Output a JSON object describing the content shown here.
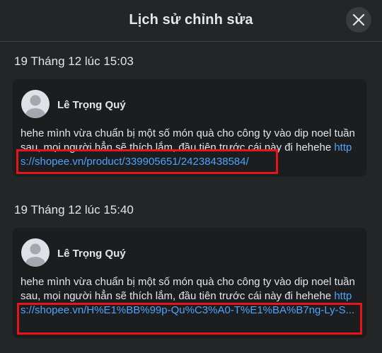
{
  "dialog": {
    "title": "Lịch sử chỉnh sửa",
    "close_icon": "close-icon"
  },
  "entries": [
    {
      "timestamp": "19 Tháng 12 lúc 15:03",
      "author": "Lê Trọng Quý",
      "text": "hehe mình vừa chuẩn bị một số món quà cho công ty vào dip noel tuần sau, mọi người hẳn sẽ thích lắm, đầu tiên trước cái này đi hehehe",
      "link": "https://shopee.vn/product/339905651/24238438584/"
    },
    {
      "timestamp": "19 Tháng 12 lúc 15:40",
      "author": "Lê Trọng Quý",
      "text": "hehe mình vừa chuẩn bị một số món quà cho công ty vào dip noel tuần sau, mọi người hẳn sẽ thích lắm, đầu tiên trước cái này đi hehehe",
      "link": "https://shopee.vn/H%E1%BB%99p-Qu%C3%A0-T%E1%BA%B7ng-Ly-S..."
    }
  ],
  "colors": {
    "background": "#242526",
    "card": "#1c1d1e",
    "link": "#4da3ff",
    "highlight": "#e8141b"
  }
}
